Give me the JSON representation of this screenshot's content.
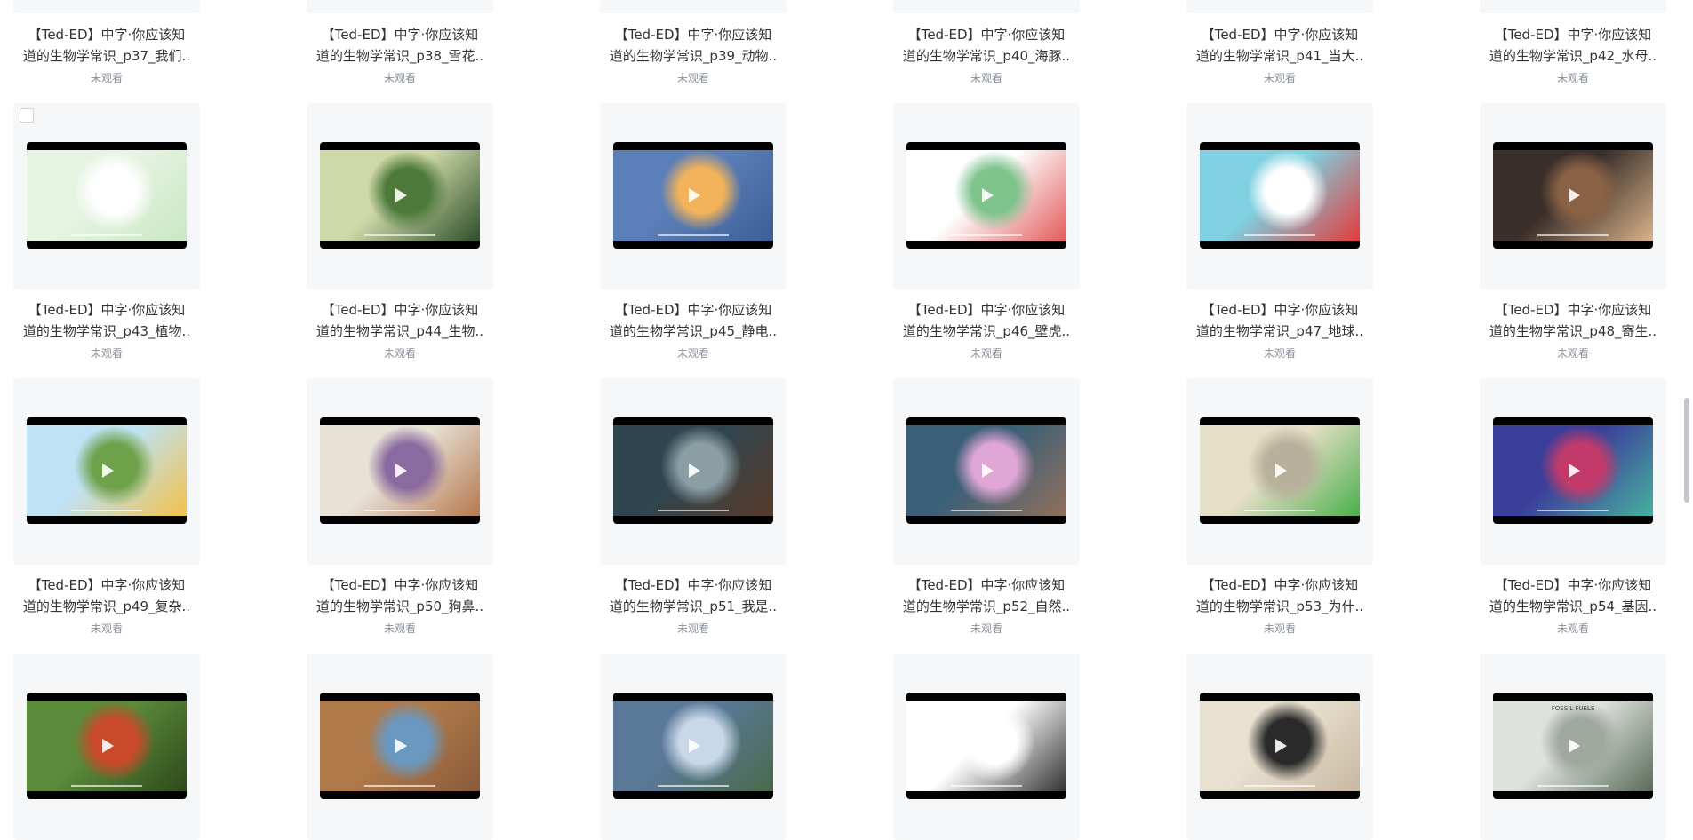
{
  "status_label": "未观看",
  "top_row": [
    {
      "title_line1": "【Ted-ED】中字·你应该知",
      "title_line2": "道的生物学常识_p37_我们.."
    },
    {
      "title_line1": "【Ted-ED】中字·你应该知",
      "title_line2": "道的生物学常识_p38_雪花.."
    },
    {
      "title_line1": "【Ted-ED】中字·你应该知",
      "title_line2": "道的生物学常识_p39_动物.."
    },
    {
      "title_line1": "【Ted-ED】中字·你应该知",
      "title_line2": "道的生物学常识_p40_海豚.."
    },
    {
      "title_line1": "【Ted-ED】中字·你应该知",
      "title_line2": "道的生物学常识_p41_当大.."
    },
    {
      "title_line1": "【Ted-ED】中字·你应该知",
      "title_line2": "道的生物学常识_p42_水母.."
    }
  ],
  "row2": [
    {
      "title_line1": "【Ted-ED】中字·你应该知",
      "title_line2": "道的生物学常识_p43_植物..",
      "thumb_colors": [
        "#e6f4e2",
        "#ffffff",
        "#c9e8c2"
      ],
      "icon": "checkbox-icon"
    },
    {
      "title_line1": "【Ted-ED】中字·你应该知",
      "title_line2": "道的生物学常识_p44_生物..",
      "thumb_colors": [
        "#cfd9a8",
        "#4d7a3a",
        "#2d4f2a"
      ]
    },
    {
      "title_line1": "【Ted-ED】中字·你应该知",
      "title_line2": "道的生物学常识_p45_静电..",
      "thumb_colors": [
        "#5b7fb8",
        "#f3b35a",
        "#3d5f98"
      ]
    },
    {
      "title_line1": "【Ted-ED】中字·你应该知",
      "title_line2": "道的生物学常识_p46_壁虎..",
      "thumb_colors": [
        "#ffffff",
        "#7fc38d",
        "#e35b5b"
      ]
    },
    {
      "title_line1": "【Ted-ED】中字·你应该知",
      "title_line2": "道的生物学常识_p47_地球..",
      "thumb_colors": [
        "#7fd0e0",
        "#ffffff",
        "#e23b3b"
      ]
    },
    {
      "title_line1": "【Ted-ED】中字·你应该知",
      "title_line2": "道的生物学常识_p48_寄生..",
      "thumb_colors": [
        "#3a2f2a",
        "#8a6245",
        "#d8b38a"
      ]
    }
  ],
  "row3": [
    {
      "title_line1": "【Ted-ED】中字·你应该知",
      "title_line2": "道的生物学常识_p49_复杂..",
      "thumb_colors": [
        "#bfe3f5",
        "#6fa14a",
        "#f2c14b"
      ]
    },
    {
      "title_line1": "【Ted-ED】中字·你应该知",
      "title_line2": "道的生物学常识_p50_狗鼻..",
      "thumb_colors": [
        "#e8e1d6",
        "#8a6a9f",
        "#b5794e"
      ]
    },
    {
      "title_line1": "【Ted-ED】中字·你应该知",
      "title_line2": "道的生物学常识_p51_我是..",
      "thumb_colors": [
        "#2f4650",
        "#8a9ea4",
        "#5a3a2a"
      ]
    },
    {
      "title_line1": "【Ted-ED】中字·你应该知",
      "title_line2": "道的生物学常识_p52_自然..",
      "thumb_colors": [
        "#3c5f78",
        "#e0a6d6",
        "#90705a"
      ]
    },
    {
      "title_line1": "【Ted-ED】中字·你应该知",
      "title_line2": "道的生物学常识_p53_为什..",
      "thumb_colors": [
        "#e6dfc8",
        "#b7b09a",
        "#4ab04a"
      ]
    },
    {
      "title_line1": "【Ted-ED】中字·你应该知",
      "title_line2": "道的生物学常识_p54_基因..",
      "thumb_colors": [
        "#3b3f9a",
        "#c23a6a",
        "#47b0a0"
      ]
    }
  ],
  "row4": [
    {
      "thumb_colors": [
        "#5a8a3a",
        "#c84a2a",
        "#2d4a1a"
      ]
    },
    {
      "thumb_colors": [
        "#b07a4a",
        "#6a98c0",
        "#8a5a3a"
      ]
    },
    {
      "thumb_colors": [
        "#5a7898",
        "#c8d8e8",
        "#4a6a4a"
      ]
    },
    {
      "thumb_colors": [
        "#ffffff",
        "#ffffff",
        "#333333"
      ]
    },
    {
      "thumb_colors": [
        "#e8e0d0",
        "#2a2a2a",
        "#c8b8a0"
      ]
    },
    {
      "thumb_colors": [
        "#dde2dc",
        "#a0a8a0",
        "#5a6a5a"
      ],
      "label": "FOSSIL FUELS"
    }
  ]
}
